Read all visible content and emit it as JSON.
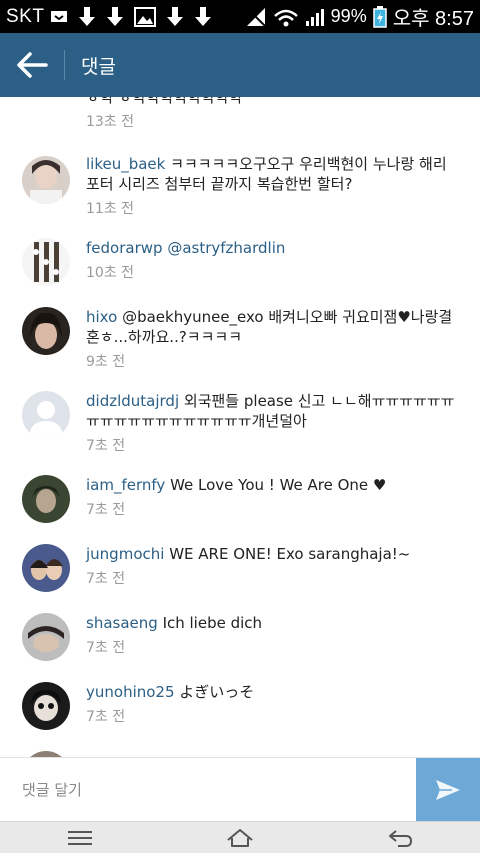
{
  "status_bar": {
    "carrier": "SKT",
    "battery": "99%",
    "time": "오후 8:57",
    "icons": [
      "message-icon",
      "download-icon",
      "download-icon",
      "image-icon",
      "download-icon",
      "download-icon",
      "mute-icon",
      "wifi-icon",
      "signal-icon",
      "battery-charging-icon"
    ]
  },
  "header": {
    "title": "댓글",
    "back_icon": "arrow-left-icon"
  },
  "comments": [
    {
      "username": "",
      "text": "ㅎ학 ㅎ학학학학학학학학",
      "time": "13초 전"
    },
    {
      "username": "likeu_baek",
      "text": "ㅋㅋㅋㅋㅋ오구오구 우리백현이 누나랑 해리포터 시리즈 첨부터 끝까지 복습한번 할터?",
      "time": "11초 전"
    },
    {
      "username": "fedorarwp",
      "text": "@astryfzhardlin",
      "time": "10초 전"
    },
    {
      "username": "hixo",
      "text": "@baekhyunee_exo  배켜니오빠 귀요미잼♥나랑결혼ㅎ...하까요..?ㅋㅋㅋㅋ",
      "time": "9초 전"
    },
    {
      "username": "didzldutajrdj",
      "text": "외국팬들 please 신고 ㄴㄴ해ㅠㅠㅠㅠㅠㅠㅠㅠㅠㅠㅠㅠㅠㅠㅠㅠㅠㅠ개년덜아",
      "time": "7초 전"
    },
    {
      "username": "iam_fernfy",
      "text": "We Love You ! We Are One ♥",
      "time": "7초 전"
    },
    {
      "username": "jungmochi",
      "text": "WE ARE ONE! Exo saranghaja!~",
      "time": "7초 전"
    },
    {
      "username": "shasaeng",
      "text": "Ich liebe dich",
      "time": "7초 전"
    },
    {
      "username": "yunohino25",
      "text": "よぎいっそ",
      "time": "7초 전"
    }
  ],
  "input": {
    "placeholder": "댓글 달기",
    "send_icon": "send-icon"
  },
  "nav": [
    "menu-icon",
    "home-icon",
    "back-icon"
  ],
  "colors": {
    "action_bar": "#2b5f86",
    "username": "#2b5f86",
    "send_button": "#6da8d6",
    "timestamp": "#9a9a9a"
  }
}
